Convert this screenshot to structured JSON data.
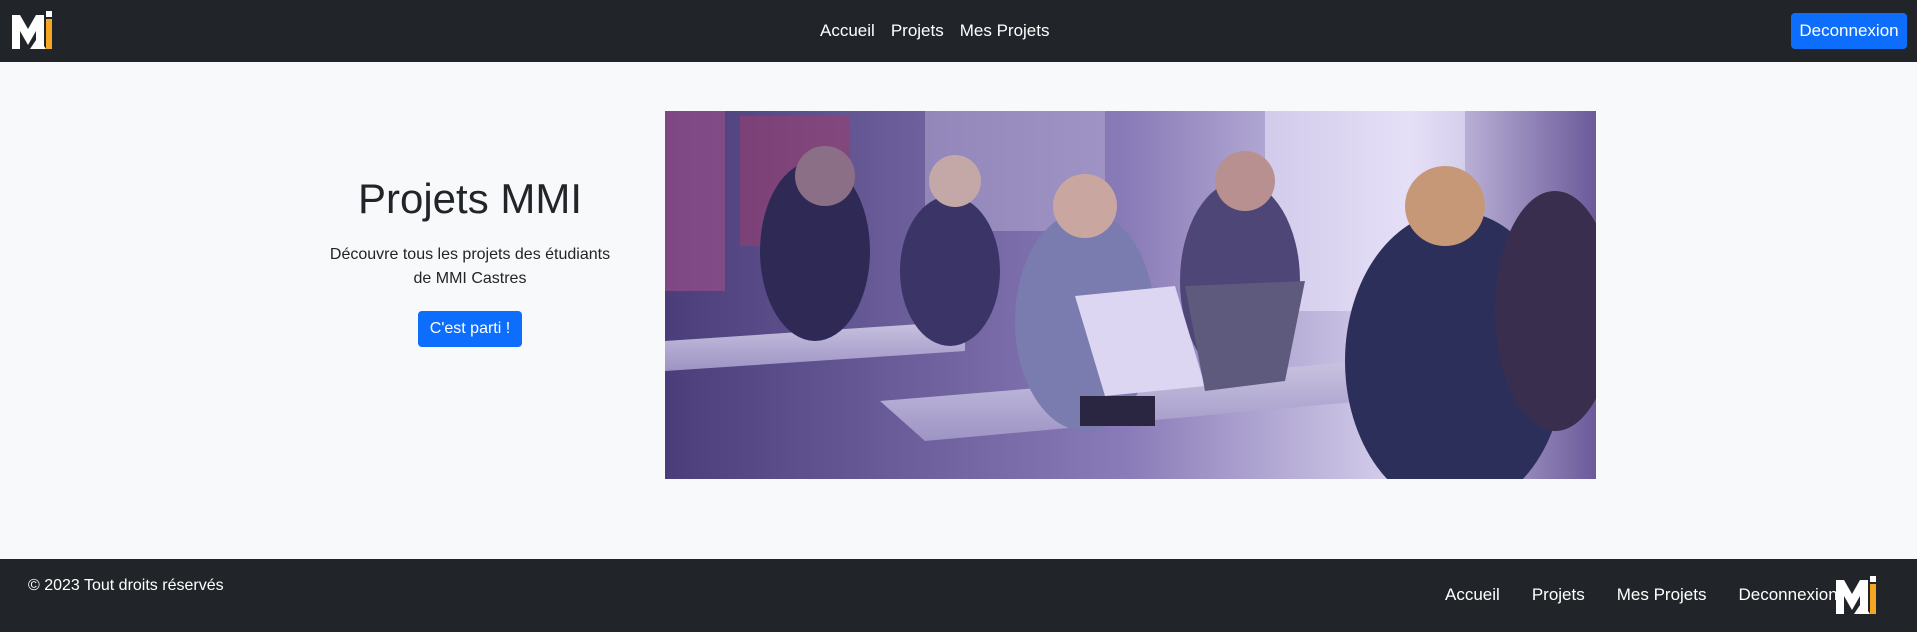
{
  "brand": {
    "logo_icon": "mmi-logo-icon"
  },
  "nav": {
    "items": [
      {
        "label": "Accueil"
      },
      {
        "label": "Projets"
      },
      {
        "label": "Mes Projets"
      }
    ],
    "logout_label": "Deconnexion"
  },
  "hero": {
    "title": "Projets MMI",
    "description": "Découvre tous les projets des étudiants de MMI Castres",
    "cta_label": "C'est parti !",
    "image_icon": "students-classroom-photo"
  },
  "footer": {
    "copyright": "© 2023 Tout droits réservés",
    "links": [
      {
        "label": "Accueil"
      },
      {
        "label": "Projets"
      },
      {
        "label": "Mes Projets"
      },
      {
        "label": "Deconnexion"
      }
    ]
  },
  "colors": {
    "navbar_bg": "#212529",
    "page_bg": "#f8f9fa",
    "primary": "#0d6efd",
    "photo_tint": "#6a4fa8"
  }
}
